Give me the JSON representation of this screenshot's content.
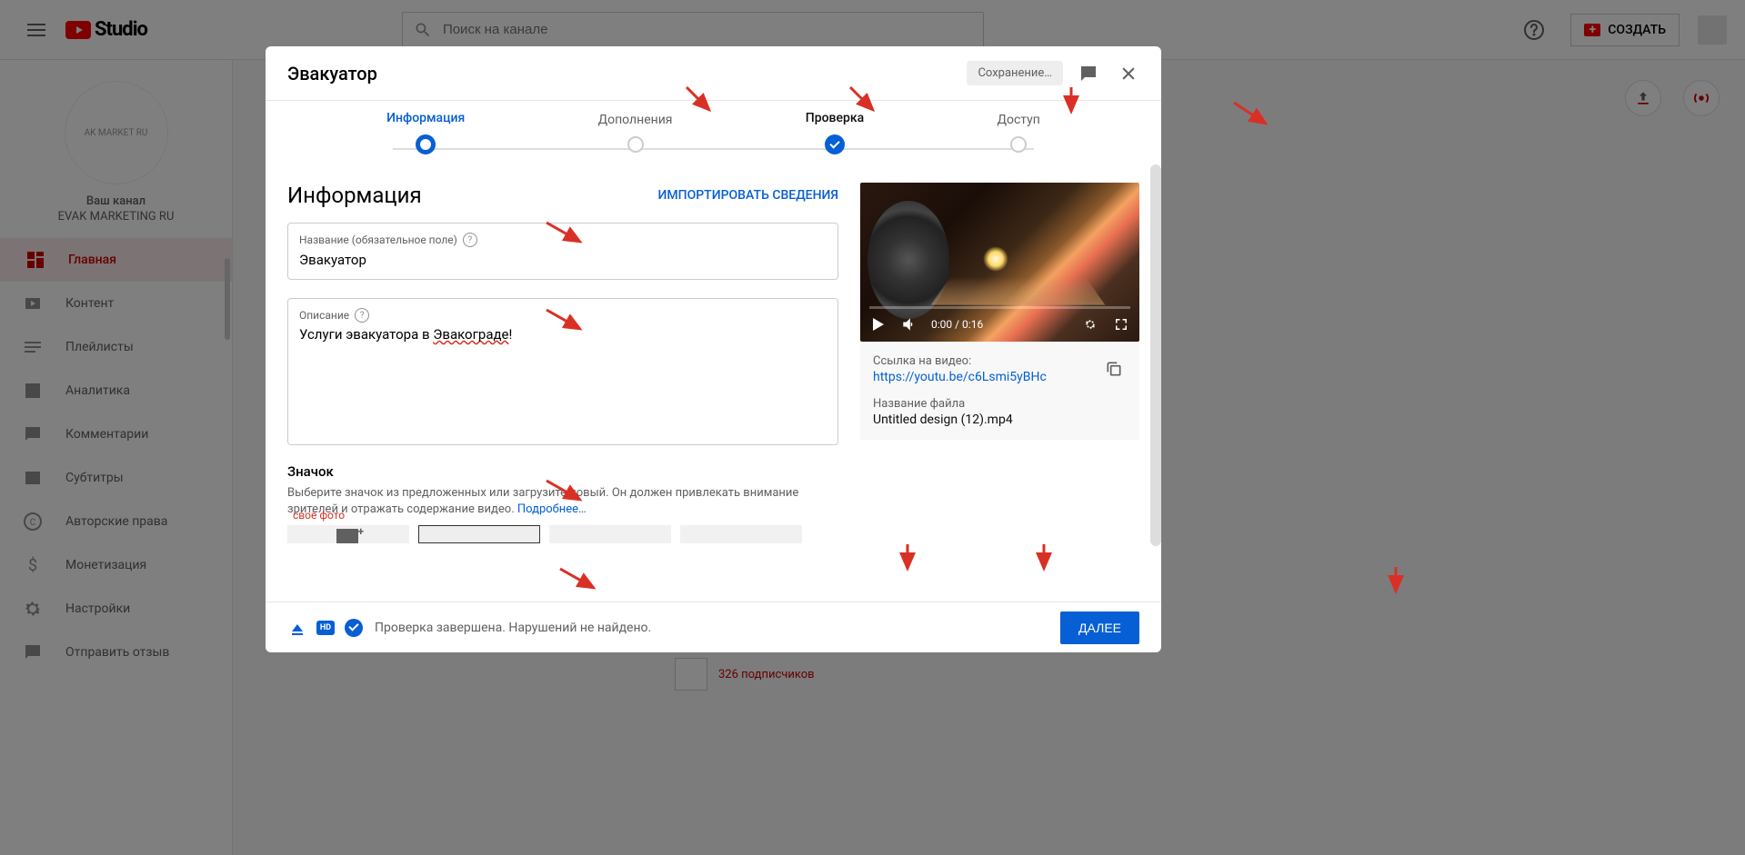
{
  "topbar": {
    "logo_text": "Studio",
    "search_placeholder": "Поиск на канале",
    "create_label": "СОЗДАТЬ"
  },
  "sidebar": {
    "channel_avatar_text": "AK MARKET\nRU",
    "channel_label": "Ваш канал",
    "channel_name": "EVAK MARKETING RU",
    "items": [
      {
        "label": "Главная",
        "icon": "dashboard",
        "active": true
      },
      {
        "label": "Контент",
        "icon": "content"
      },
      {
        "label": "Плейлисты",
        "icon": "playlist"
      },
      {
        "label": "Аналитика",
        "icon": "analytics"
      },
      {
        "label": "Комментарии",
        "icon": "comments"
      },
      {
        "label": "Субтитры",
        "icon": "subtitles"
      },
      {
        "label": "Авторские права",
        "icon": "copyright"
      },
      {
        "label": "Монетизация",
        "icon": "monetize"
      },
      {
        "label": "Настройки",
        "icon": "settings"
      },
      {
        "label": "Отправить отзыв",
        "icon": "feedback"
      }
    ]
  },
  "modal": {
    "title": "Эвакуатор",
    "saving": "Сохранение…",
    "steps": [
      {
        "label": "Информация",
        "state": "active"
      },
      {
        "label": "Дополнения",
        "state": "idle"
      },
      {
        "label": "Проверка",
        "state": "done"
      },
      {
        "label": "Доступ",
        "state": "idle"
      }
    ],
    "section_title": "Информация",
    "import_link": "ИМПОРТИРОВАТЬ СВЕДЕНИЯ",
    "title_field_label": "Название (обязательное поле)",
    "title_field_value": "Эвакуатор",
    "desc_field_label": "Описание",
    "desc_prefix": "Услуги эвакуатора в ",
    "desc_underlined": "Эвакограде",
    "desc_suffix": "!",
    "thumb_title": "Значок",
    "thumb_desc": "Выберите значок из предложенных или загрузите новый. Он должен привлекать внимание зрителей и отражать содержание видео. ",
    "thumb_link": "Подробнее…",
    "thumb_own_label": "своё фото",
    "video": {
      "time": "0:00 / 0:16",
      "link_label": "Ссылка на видео:",
      "link_url": "https://youtu.be/c6Lsmi5yBHc",
      "filename_label": "Название файла",
      "filename": "Untitled design (12).mp4"
    },
    "footer_status": "Проверка завершена. Нарушений не найдено.",
    "next_button": "ДАЛЕЕ"
  },
  "subs_text": "326 подписчиков"
}
